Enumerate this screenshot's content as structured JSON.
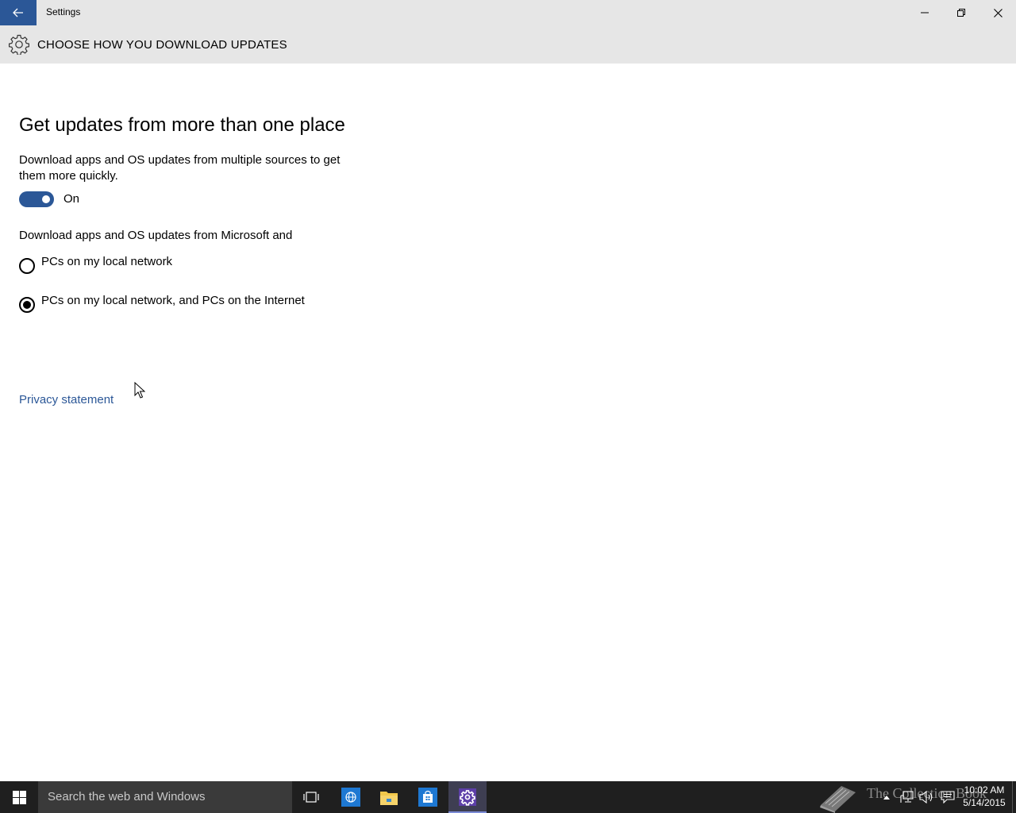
{
  "window": {
    "title": "Settings"
  },
  "header": {
    "title": "CHOOSE HOW YOU DOWNLOAD UPDATES",
    "icon": "gear-icon"
  },
  "main": {
    "section_title": "Get updates from more than one place",
    "description": "Download apps and OS updates from multiple sources to get them more quickly.",
    "toggle": {
      "state": "on",
      "label": "On"
    },
    "radio_heading": "Download apps and OS updates from Microsoft and",
    "radio_options": [
      {
        "label": "PCs on my local network",
        "selected": false
      },
      {
        "label": "PCs on my local network, and PCs on the Internet",
        "selected": true
      }
    ],
    "privacy_link": "Privacy statement"
  },
  "taskbar": {
    "search_placeholder": "Search the web and Windows",
    "apps": [
      "task-view",
      "internet-explorer",
      "file-explorer",
      "store",
      "settings"
    ],
    "active_app": "settings",
    "watermark": "The Collection Book",
    "clock_time": "10:02 AM",
    "clock_date": "5/14/2015"
  },
  "colors": {
    "accent": "#2b5797",
    "titlebar": "#e6e6e6",
    "taskbar": "#1f1f1f"
  }
}
